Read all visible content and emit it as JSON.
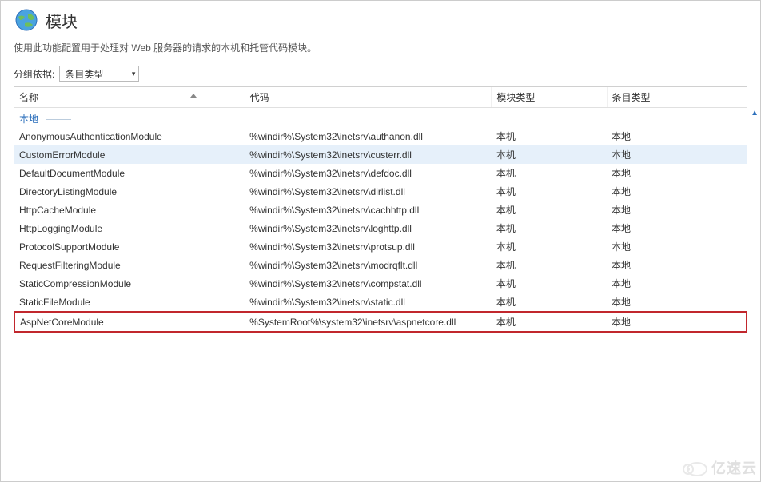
{
  "header": {
    "title": "模块",
    "description": "使用此功能配置用于处理对 Web 服务器的请求的本机和托管代码模块。"
  },
  "toolbar": {
    "group_label": "分组依据:",
    "group_value": "条目类型"
  },
  "columns": {
    "name": "名称",
    "code": "代码",
    "module_type": "模块类型",
    "entry_type": "条目类型"
  },
  "group": {
    "local": "本地"
  },
  "rows": [
    {
      "name": "AnonymousAuthenticationModule",
      "code": "%windir%\\System32\\inetsrv\\authanon.dll",
      "mtype": "本机",
      "etype": "本地",
      "selected": false,
      "highlight": false
    },
    {
      "name": "CustomErrorModule",
      "code": "%windir%\\System32\\inetsrv\\custerr.dll",
      "mtype": "本机",
      "etype": "本地",
      "selected": true,
      "highlight": false
    },
    {
      "name": "DefaultDocumentModule",
      "code": "%windir%\\System32\\inetsrv\\defdoc.dll",
      "mtype": "本机",
      "etype": "本地",
      "selected": false,
      "highlight": false
    },
    {
      "name": "DirectoryListingModule",
      "code": "%windir%\\System32\\inetsrv\\dirlist.dll",
      "mtype": "本机",
      "etype": "本地",
      "selected": false,
      "highlight": false
    },
    {
      "name": "HttpCacheModule",
      "code": "%windir%\\System32\\inetsrv\\cachhttp.dll",
      "mtype": "本机",
      "etype": "本地",
      "selected": false,
      "highlight": false
    },
    {
      "name": "HttpLoggingModule",
      "code": "%windir%\\System32\\inetsrv\\loghttp.dll",
      "mtype": "本机",
      "etype": "本地",
      "selected": false,
      "highlight": false
    },
    {
      "name": "ProtocolSupportModule",
      "code": "%windir%\\System32\\inetsrv\\protsup.dll",
      "mtype": "本机",
      "etype": "本地",
      "selected": false,
      "highlight": false
    },
    {
      "name": "RequestFilteringModule",
      "code": "%windir%\\System32\\inetsrv\\modrqflt.dll",
      "mtype": "本机",
      "etype": "本地",
      "selected": false,
      "highlight": false
    },
    {
      "name": "StaticCompressionModule",
      "code": "%windir%\\System32\\inetsrv\\compstat.dll",
      "mtype": "本机",
      "etype": "本地",
      "selected": false,
      "highlight": false
    },
    {
      "name": "StaticFileModule",
      "code": "%windir%\\System32\\inetsrv\\static.dll",
      "mtype": "本机",
      "etype": "本地",
      "selected": false,
      "highlight": false
    },
    {
      "name": "AspNetCoreModule",
      "code": "%SystemRoot%\\system32\\inetsrv\\aspnetcore.dll",
      "mtype": "本机",
      "etype": "本地",
      "selected": false,
      "highlight": true
    }
  ],
  "watermark": {
    "text": "亿速云"
  }
}
